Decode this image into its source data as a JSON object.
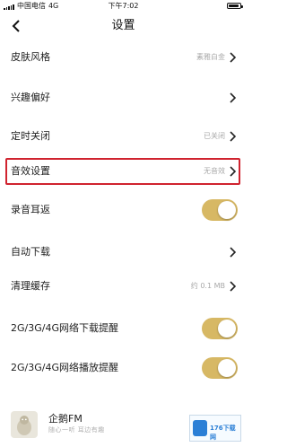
{
  "status_bar": {
    "carrier": "中国电信",
    "network": "4G",
    "time": "下午7:02"
  },
  "header": {
    "title": "设置"
  },
  "settings": [
    {
      "label": "皮肤风格",
      "value": "素雅白金",
      "control": "chevron"
    },
    {
      "label": "兴趣偏好",
      "value": "",
      "control": "chevron"
    },
    {
      "label": "定时关闭",
      "value": "已关闭",
      "control": "chevron"
    },
    {
      "label": "音效设置",
      "value": "无音效",
      "control": "chevron",
      "highlighted": true
    },
    {
      "label": "录音耳返",
      "value": "",
      "control": "toggle",
      "on": true
    },
    {
      "label": "自动下载",
      "value": "",
      "control": "chevron"
    },
    {
      "label": "清理缓存",
      "value": "约 0.1 MB",
      "control": "chevron"
    },
    {
      "label": "2G/3G/4G网络下载提醒",
      "value": "",
      "control": "toggle",
      "on": true
    },
    {
      "label": "2G/3G/4G网络播放提醒",
      "value": "",
      "control": "toggle",
      "on": true
    }
  ],
  "app_info": {
    "name": "企鹅FM",
    "slogan": "随心一听 耳边有趣"
  },
  "watermark": {
    "text": "176下载网"
  },
  "colors": {
    "toggle_on": "#d7b864",
    "highlight": "#d0232f"
  }
}
